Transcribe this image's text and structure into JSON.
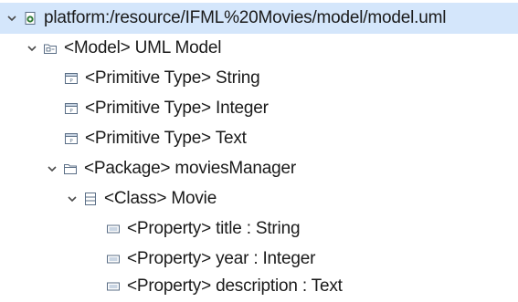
{
  "tree": {
    "root": {
      "label": "platform:/resource/IFML%20Movies/model/model.uml",
      "icon": "resource-file-icon",
      "expanded": true,
      "selected": true
    },
    "model": {
      "label": "<Model> UML Model",
      "icon": "model-icon",
      "expanded": true
    },
    "primitive_types": [
      {
        "label": "<Primitive Type> String",
        "icon": "primitive-type-icon"
      },
      {
        "label": "<Primitive Type> Integer",
        "icon": "primitive-type-icon"
      },
      {
        "label": "<Primitive Type> Text",
        "icon": "primitive-type-icon"
      }
    ],
    "package": {
      "label": "<Package> moviesManager",
      "icon": "package-icon",
      "expanded": true
    },
    "class": {
      "label": "<Class> Movie",
      "icon": "class-icon",
      "expanded": true
    },
    "properties": [
      {
        "label": "<Property> title : String",
        "icon": "property-icon"
      },
      {
        "label": "<Property> year : Integer",
        "icon": "property-icon"
      },
      {
        "label": "<Property> description : Text",
        "icon": "property-icon"
      }
    ]
  },
  "colors": {
    "selection_bg": "#d4e6fb",
    "twisty": "#4a4a4a",
    "icon_stroke": "#5a6e86",
    "resource_icon": "#2f7a34"
  }
}
